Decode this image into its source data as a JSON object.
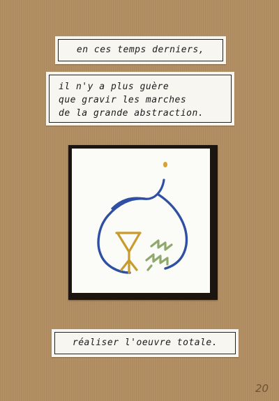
{
  "captions": {
    "top": "en ces temps derniers,",
    "middle": [
      "il n'y a plus guère",
      "que gravir les marches",
      "de la grande abstraction."
    ],
    "bottom": "réaliser l'oeuvre totale."
  },
  "artwork": {
    "description_icons": [
      "bulb-outline",
      "rune-symbol",
      "zigzag-symbol",
      "dot"
    ],
    "colors": {
      "bulb_stroke": "#2e4fa3",
      "rune": "#c99a2e",
      "zigzag": "#8fa86b",
      "dot": "#d8a232"
    }
  },
  "page_number": "20",
  "colors": {
    "background": "#b38f63",
    "card": "#f7f6f1",
    "ink": "#1a1a1a"
  }
}
